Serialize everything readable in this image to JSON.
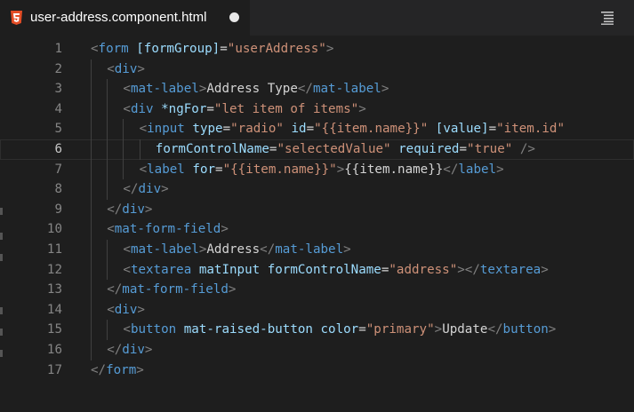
{
  "tab": {
    "title": "user-address.component.html",
    "file_icon": "html5-icon",
    "modified_indicator": "unsaved-dot",
    "menu_icon": "editor-outline-icon"
  },
  "colors": {
    "background": "#1e1e1e",
    "tag": "#569cd6",
    "attribute": "#9cdcfe",
    "string": "#ce9178",
    "punctuation": "#808080",
    "text": "#d4d4d4",
    "html_icon": "#e44d26"
  },
  "editor": {
    "current_line": 6,
    "lines": [
      {
        "n": "1",
        "t": [
          [
            "t",
            "<"
          ],
          [
            "tag",
            "form"
          ],
          [
            "txt",
            " "
          ],
          [
            "attr",
            "[formGroup]"
          ],
          [
            "txt",
            "="
          ],
          [
            "str",
            "\"userAddress\""
          ],
          [
            "t",
            ">"
          ]
        ]
      },
      {
        "n": "2",
        "t": [
          [
            "t",
            "<"
          ],
          [
            "tag",
            "div"
          ],
          [
            "t",
            ">"
          ]
        ]
      },
      {
        "n": "3",
        "t": [
          [
            "t",
            "<"
          ],
          [
            "tag",
            "mat-label"
          ],
          [
            "t",
            ">"
          ],
          [
            "txt",
            "Address Type"
          ],
          [
            "t",
            "</"
          ],
          [
            "tag",
            "mat-label"
          ],
          [
            "t",
            ">"
          ]
        ]
      },
      {
        "n": "4",
        "t": [
          [
            "t",
            "<"
          ],
          [
            "tag",
            "div"
          ],
          [
            "txt",
            " "
          ],
          [
            "attr",
            "*ngFor"
          ],
          [
            "txt",
            "="
          ],
          [
            "str",
            "\"let item of items\""
          ],
          [
            "t",
            ">"
          ]
        ]
      },
      {
        "n": "5",
        "t": [
          [
            "t",
            "<"
          ],
          [
            "tag",
            "input"
          ],
          [
            "txt",
            " "
          ],
          [
            "attr",
            "type"
          ],
          [
            "txt",
            "="
          ],
          [
            "str",
            "\"radio\""
          ],
          [
            "txt",
            " "
          ],
          [
            "attr",
            "id"
          ],
          [
            "txt",
            "="
          ],
          [
            "str",
            "\"{{item.name}}\""
          ],
          [
            "txt",
            " "
          ],
          [
            "attr",
            "[value]"
          ],
          [
            "txt",
            "="
          ],
          [
            "str",
            "\"item.id\""
          ]
        ]
      },
      {
        "n": "6",
        "t": [
          [
            "attr",
            "formControlName"
          ],
          [
            "txt",
            "="
          ],
          [
            "str",
            "\"selectedValue\""
          ],
          [
            "txt",
            " "
          ],
          [
            "attr",
            "required"
          ],
          [
            "txt",
            "="
          ],
          [
            "str",
            "\"true\""
          ],
          [
            "txt",
            " "
          ],
          [
            "t",
            "/>"
          ]
        ]
      },
      {
        "n": "7",
        "t": [
          [
            "t",
            "<"
          ],
          [
            "tag",
            "label"
          ],
          [
            "txt",
            " "
          ],
          [
            "attr",
            "for"
          ],
          [
            "txt",
            "="
          ],
          [
            "str",
            "\"{{item.name}}\""
          ],
          [
            "t",
            ">"
          ],
          [
            "txt",
            "{{item.name}}"
          ],
          [
            "t",
            "</"
          ],
          [
            "tag",
            "label"
          ],
          [
            "t",
            ">"
          ]
        ]
      },
      {
        "n": "8",
        "t": [
          [
            "t",
            "</"
          ],
          [
            "tag",
            "div"
          ],
          [
            "t",
            ">"
          ]
        ]
      },
      {
        "n": "9",
        "t": [
          [
            "t",
            "</"
          ],
          [
            "tag",
            "div"
          ],
          [
            "t",
            ">"
          ]
        ]
      },
      {
        "n": "10",
        "t": [
          [
            "t",
            "<"
          ],
          [
            "tag",
            "mat-form-field"
          ],
          [
            "t",
            ">"
          ]
        ]
      },
      {
        "n": "11",
        "t": [
          [
            "t",
            "<"
          ],
          [
            "tag",
            "mat-label"
          ],
          [
            "t",
            ">"
          ],
          [
            "txt",
            "Address"
          ],
          [
            "t",
            "</"
          ],
          [
            "tag",
            "mat-label"
          ],
          [
            "t",
            ">"
          ]
        ]
      },
      {
        "n": "12",
        "t": [
          [
            "t",
            "<"
          ],
          [
            "tag",
            "textarea"
          ],
          [
            "txt",
            " "
          ],
          [
            "attr",
            "matInput"
          ],
          [
            "txt",
            " "
          ],
          [
            "attr",
            "formControlName"
          ],
          [
            "txt",
            "="
          ],
          [
            "str",
            "\"address\""
          ],
          [
            "t",
            "></"
          ],
          [
            "tag",
            "textarea"
          ],
          [
            "t",
            ">"
          ]
        ]
      },
      {
        "n": "13",
        "t": [
          [
            "t",
            "</"
          ],
          [
            "tag",
            "mat-form-field"
          ],
          [
            "t",
            ">"
          ]
        ]
      },
      {
        "n": "14",
        "t": [
          [
            "t",
            "<"
          ],
          [
            "tag",
            "div"
          ],
          [
            "t",
            ">"
          ]
        ]
      },
      {
        "n": "15",
        "t": [
          [
            "t",
            "<"
          ],
          [
            "tag",
            "button"
          ],
          [
            "txt",
            " "
          ],
          [
            "attr",
            "mat-raised-button"
          ],
          [
            "txt",
            " "
          ],
          [
            "attr",
            "color"
          ],
          [
            "txt",
            "="
          ],
          [
            "str",
            "\"primary\""
          ],
          [
            "t",
            ">"
          ],
          [
            "txt",
            "Update"
          ],
          [
            "t",
            "</"
          ],
          [
            "tag",
            "button"
          ],
          [
            "t",
            ">"
          ]
        ]
      },
      {
        "n": "16",
        "t": [
          [
            "t",
            "</"
          ],
          [
            "tag",
            "div"
          ],
          [
            "t",
            ">"
          ]
        ]
      },
      {
        "n": "17",
        "t": [
          [
            "t",
            "</"
          ],
          [
            "tag",
            "form"
          ],
          [
            "t",
            ">"
          ]
        ]
      }
    ]
  }
}
